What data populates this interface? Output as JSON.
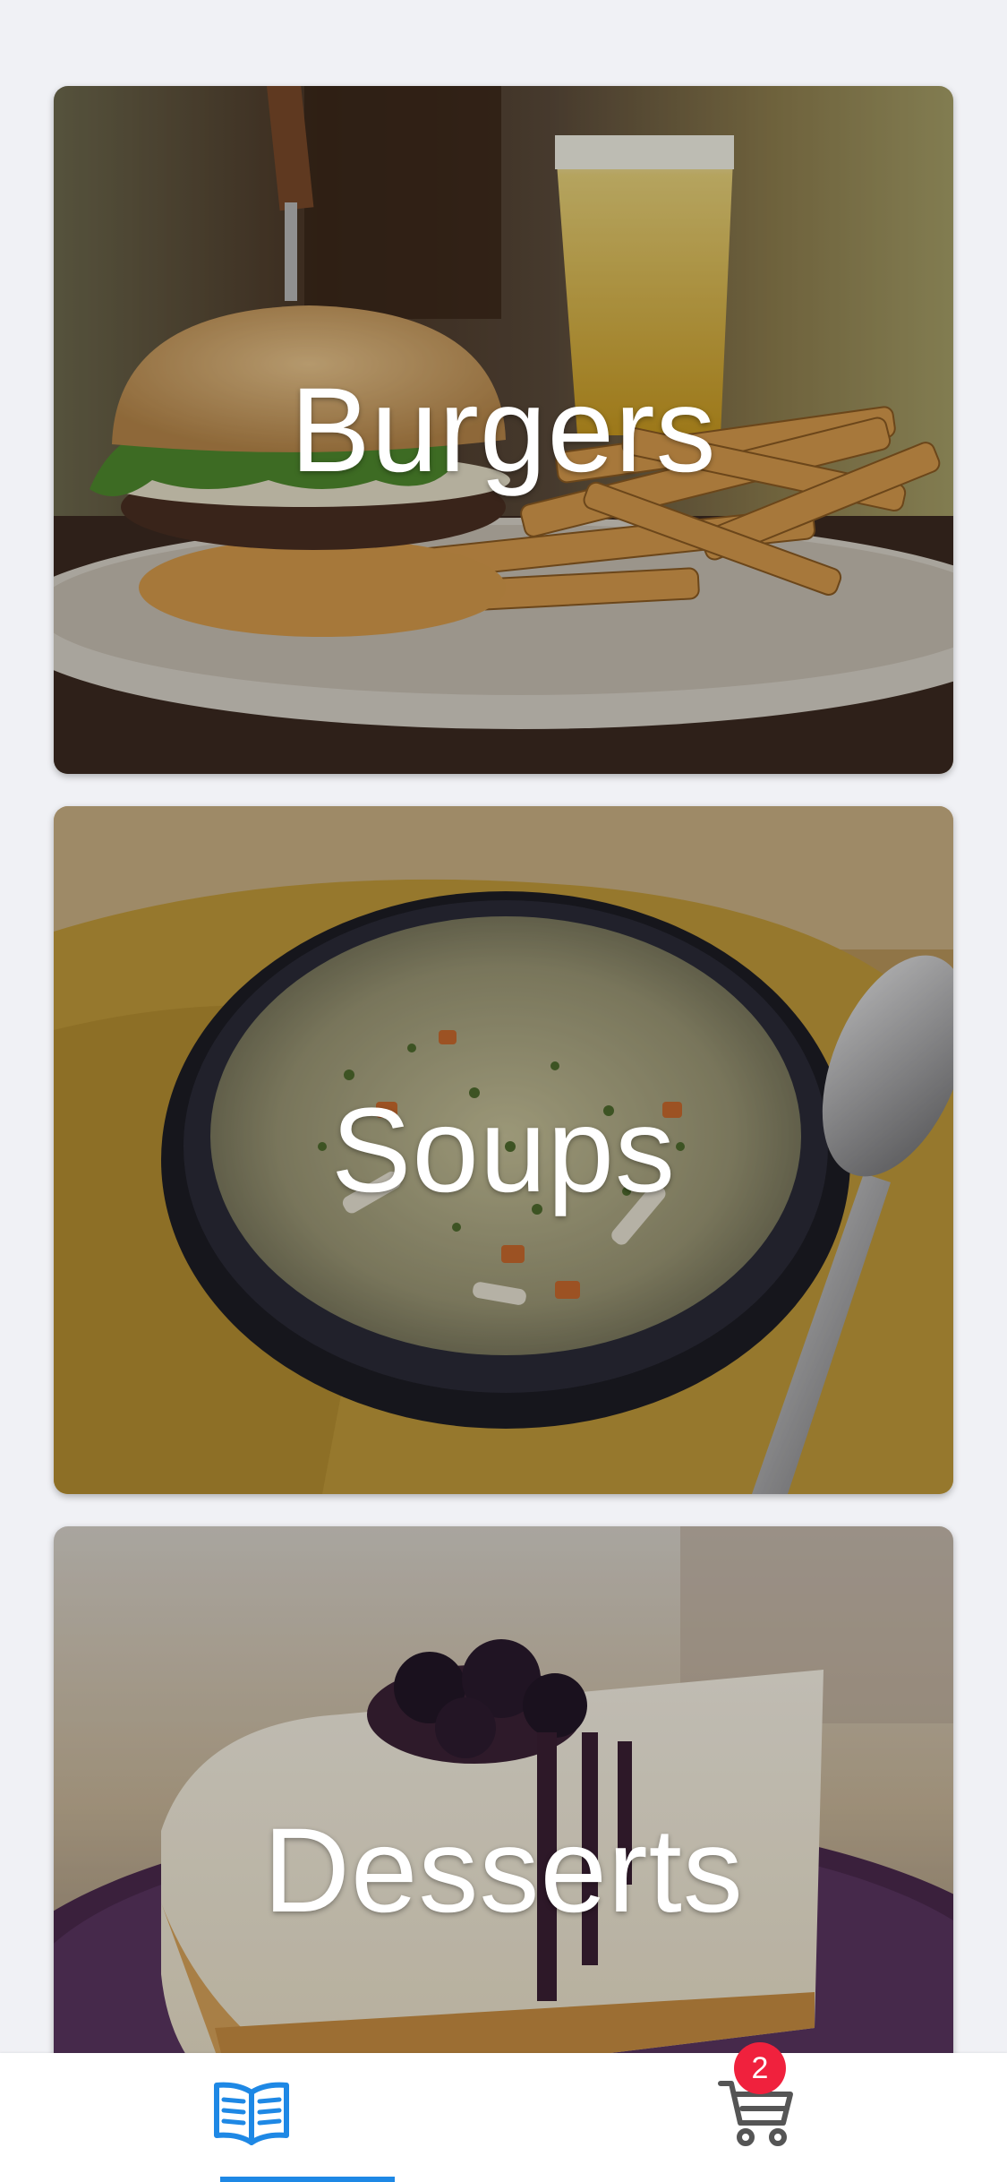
{
  "categories": [
    {
      "title": "Burgers"
    },
    {
      "title": "Soups"
    },
    {
      "title": "Desserts"
    }
  ],
  "tab_bar": {
    "menu_icon": "book-open-icon",
    "cart_icon": "cart-icon",
    "cart_badge": "2",
    "active_tab": "menu"
  },
  "colors": {
    "accent": "#1e88e5",
    "badge": "#f0213d",
    "inactive_icon": "#555555"
  }
}
